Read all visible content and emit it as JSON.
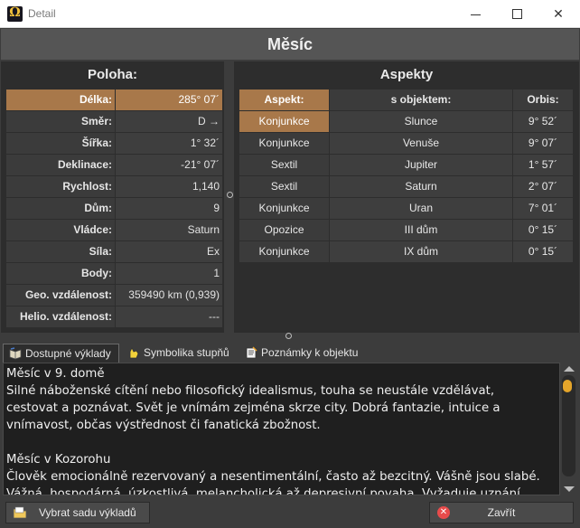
{
  "window": {
    "title": "Detail"
  },
  "header": {
    "title": "Měsíc"
  },
  "position": {
    "title": "Poloha:",
    "rows": [
      {
        "label": "Délka:",
        "value": "285° 07´"
      },
      {
        "label": "Směr:",
        "value": "D →"
      },
      {
        "label": "Šířka:",
        "value": "1° 32´"
      },
      {
        "label": "Deklinace:",
        "value": "-21° 07´"
      },
      {
        "label": "Rychlost:",
        "value": "1,140"
      },
      {
        "label": "Dům:",
        "value": "9"
      },
      {
        "label": "Vládce:",
        "value": "Saturn"
      },
      {
        "label": "Síla:",
        "value": "Ex"
      },
      {
        "label": "Body:",
        "value": "1"
      },
      {
        "label": "Geo. vzdálenost:",
        "value": "359490 km (0,939)"
      },
      {
        "label": "Helio. vzdálenost:",
        "value": "---"
      }
    ]
  },
  "aspects": {
    "title": "Aspekty",
    "headers": {
      "aspect": "Aspekt:",
      "object": "s objektem:",
      "orb": "Orbis:"
    },
    "rows": [
      {
        "aspect": "Konjunkce",
        "object": "Slunce",
        "orb": "9° 52´"
      },
      {
        "aspect": "Konjunkce",
        "object": "Venuše",
        "orb": "9° 07´"
      },
      {
        "aspect": "Sextil",
        "object": "Jupiter",
        "orb": "1° 57´"
      },
      {
        "aspect": "Sextil",
        "object": "Saturn",
        "orb": "2° 07´"
      },
      {
        "aspect": "Konjunkce",
        "object": "Uran",
        "orb": "7° 01´"
      },
      {
        "aspect": "Opozice",
        "object": "III dům",
        "orb": "0° 15´"
      },
      {
        "aspect": "Konjunkce",
        "object": "IX dům",
        "orb": "0° 15´"
      }
    ]
  },
  "tabs": [
    {
      "label": "Dostupné výklady",
      "icon": "book-icon"
    },
    {
      "label": "Symbolika stupňů",
      "icon": "hand-icon"
    },
    {
      "label": "Poznámky k objektu",
      "icon": "notes-icon"
    }
  ],
  "interpretation": {
    "p1_title": "Měsíc v 9. domě",
    "p1_text": "Silné náboženské cítění nebo filosofický idealismus, touha se neustále vzdělávat, cestovat a poznávat. Svět je vnímám zejména skrze city. Dobrá fantazie, intuice a vnímavost, občas výstřednost či fanatická zbožnost.",
    "p2_title": "Měsíc v Kozorohu",
    "p2_text": "Člověk emocionálně rezervovaný a nesentimentální, často až bezcitný. Vášně jsou slabé. Vážná, hospodárná, úzkostlivá, melancholická až depresivní povaha. Vyžaduje uznání okolí. Často vůdčí"
  },
  "buttons": {
    "select_set": "Vybrat sadu výkladů",
    "close": "Zavřít"
  },
  "colors": {
    "accent": "#a8784a",
    "background": "#3c3c3c",
    "panel": "#2d2d2d"
  }
}
